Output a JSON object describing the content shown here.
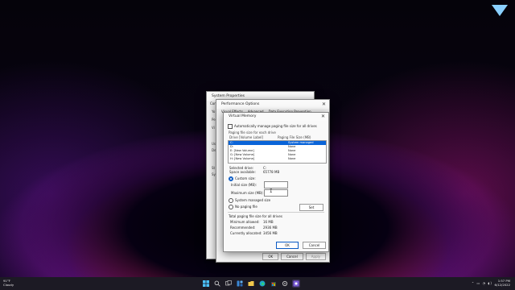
{
  "system_properties": {
    "title": "System Properties",
    "tab_fragment": "Comp",
    "side_labels": [
      "Yo",
      "Pe",
      "Vi",
      "Us",
      "De",
      "St",
      "Sy"
    ],
    "buttons": {
      "ok": "OK",
      "cancel": "Cancel",
      "apply": "Apply"
    }
  },
  "performance_options": {
    "title": "Performance Options",
    "tabs": [
      "Visual Effects",
      "Advanced",
      "Data Execution Prevention"
    ]
  },
  "virtual_memory": {
    "title": "Virtual Memory",
    "auto_manage_label": "Automatically manage paging file size for all drives",
    "auto_manage_checked": false,
    "group_label": "Paging file size for each drive",
    "col_drive": "Drive  [Volume Label]",
    "col_size": "Paging File Size (MB)",
    "drives": [
      {
        "drive": "C:",
        "size": "System managed",
        "selected": true
      },
      {
        "drive": "D:",
        "size": "None",
        "selected": false
      },
      {
        "drive": "E:      [New Volume]",
        "size": "None",
        "selected": false
      },
      {
        "drive": "G:      [New Volume]",
        "size": "None",
        "selected": false
      },
      {
        "drive": "H:      [New Volume]",
        "size": "None",
        "selected": false
      }
    ],
    "selected_drive_label": "Selected drive:",
    "selected_drive_value": "C:",
    "space_available_label": "Space available:",
    "space_available_value": "65778 MB",
    "custom_size_label": "Custom size:",
    "initial_size_label": "Initial size (MB):",
    "initial_size_value": "",
    "maximum_size_label": "Maximum size (MB):",
    "maximum_size_value": "",
    "system_managed_label": "System managed size",
    "no_paging_label": "No paging file",
    "set_button": "Set",
    "total_label": "Total paging file size for all drives",
    "min_allowed_label": "Minimum allowed:",
    "min_allowed_value": "16 MB",
    "recommended_label": "Recommended:",
    "recommended_value": "2936 MB",
    "currently_allocated_label": "Currently allocated:",
    "currently_allocated_value": "3456 MB",
    "ok_button": "OK",
    "cancel_button": "Cancel"
  },
  "taskbar": {
    "temperature": "91°F",
    "weather": "Cloudy",
    "time": "1:57 PM",
    "date": "6/12/2022",
    "app_icons": [
      "windows-start-icon",
      "search-icon",
      "task-view-icon",
      "widgets-icon",
      "file-explorer-icon",
      "edge-icon",
      "store-icon",
      "settings-icon",
      "photos-icon"
    ]
  },
  "colors": {
    "accent": "#0a64d8",
    "taskbar": "#1c1a24"
  }
}
